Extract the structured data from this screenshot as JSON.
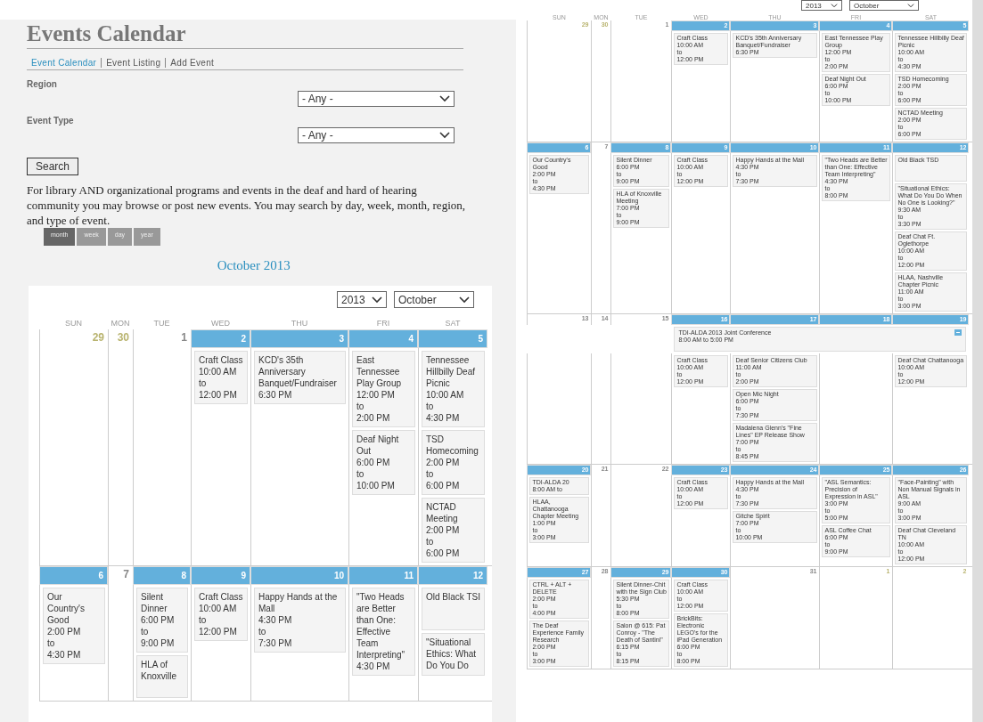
{
  "left": {
    "title": "Events Calendar",
    "nav": [
      {
        "label": "Event Calendar",
        "selected": true
      },
      {
        "label": "Event Listing",
        "selected": false
      },
      {
        "label": "Add Event",
        "selected": false
      }
    ],
    "filters": [
      {
        "label": "Region",
        "value": "- Any -"
      },
      {
        "label": "Event Type",
        "value": "- Any -"
      }
    ],
    "search_button": "Search",
    "description": "For library AND organizational programs and events in the deaf and hard of hearing community you may browse or post new events. You may search by day, week, month, region, and type of event.",
    "views": [
      {
        "label": "month",
        "selected": true
      },
      {
        "label": "week",
        "selected": false
      },
      {
        "label": "day",
        "selected": false
      },
      {
        "label": "year",
        "selected": false
      }
    ],
    "month_title": "October 2013",
    "year_select": "2013",
    "month_select": "October",
    "calendar": {
      "weekdays": [
        "SUN",
        "MON",
        "TUE",
        "WED",
        "THU",
        "FRI",
        "SAT"
      ],
      "weeks": [
        {
          "days": [
            {
              "day": "29",
              "other_month": true,
              "has_events": false
            },
            {
              "day": "30",
              "other_month": true,
              "has_events": false
            },
            {
              "day": "1",
              "other_month": false,
              "has_events": false
            },
            {
              "day": "2",
              "other_month": false,
              "has_events": true,
              "events": [
                {
                  "title": "Craft Class",
                  "lines": [
                    "10:00 AM",
                    "to",
                    "12:00 PM"
                  ]
                }
              ]
            },
            {
              "day": "3",
              "other_month": false,
              "has_events": true,
              "events": [
                {
                  "title": "KCD's 35th Anniversary Banquet/Fundraiser",
                  "lines": [
                    "6:30 PM"
                  ]
                }
              ]
            },
            {
              "day": "4",
              "other_month": false,
              "has_events": true,
              "events": [
                {
                  "title": "East Tennessee Play Group",
                  "lines": [
                    "12:00 PM",
                    "to",
                    "2:00 PM"
                  ]
                },
                {
                  "title": "Deaf Night Out",
                  "lines": [
                    "6:00 PM",
                    "to",
                    "10:00 PM"
                  ]
                }
              ]
            },
            {
              "day": "5",
              "other_month": false,
              "has_events": true,
              "events": [
                {
                  "title": "Tennessee Hillbilly Deaf Picnic",
                  "lines": [
                    "10:00 AM",
                    "to",
                    "4:30 PM"
                  ]
                },
                {
                  "title": "TSD Homecoming",
                  "lines": [
                    "2:00 PM",
                    "to",
                    "6:00 PM"
                  ]
                },
                {
                  "title": "NCTAD Meeting",
                  "lines": [
                    "2:00 PM",
                    "to",
                    "6:00 PM"
                  ]
                }
              ]
            }
          ]
        },
        {
          "days": [
            {
              "day": "6",
              "other_month": false,
              "has_events": true,
              "events": [
                {
                  "title": "Our Country's Good",
                  "lines": [
                    "2:00 PM",
                    "to",
                    "4:30 PM"
                  ]
                }
              ]
            },
            {
              "day": "7",
              "other_month": false,
              "has_events": false
            },
            {
              "day": "8",
              "other_month": false,
              "has_events": true,
              "events": [
                {
                  "title": "Silent Dinner",
                  "lines": [
                    "6:00 PM",
                    "to",
                    "9:00 PM"
                  ]
                },
                {
                  "title": "HLA of Knoxville"
                }
              ]
            },
            {
              "day": "9",
              "other_month": false,
              "has_events": true,
              "events": [
                {
                  "title": "Craft Class",
                  "lines": [
                    "10:00 AM",
                    "to",
                    "12:00 PM"
                  ]
                }
              ]
            },
            {
              "day": "10",
              "other_month": false,
              "has_events": true,
              "events": [
                {
                  "title": "Happy Hands at the Mall",
                  "lines": [
                    "4:30 PM",
                    "to",
                    "7:30 PM"
                  ]
                }
              ]
            },
            {
              "day": "11",
              "other_month": false,
              "has_events": true,
              "events": [
                {
                  "title": "\"Two Heads are Better than One: Effective Team Interpreting\"",
                  "lines": [
                    "4:30 PM"
                  ]
                }
              ]
            },
            {
              "day": "12",
              "other_month": false,
              "has_events": true,
              "events": [
                {
                  "title": "Old Black TSI"
                },
                {
                  "title": "\"Situational Ethics: What Do You Do"
                }
              ]
            }
          ]
        }
      ]
    }
  },
  "right": {
    "year_select": "2013",
    "month_select": "October",
    "calendar": {
      "weekdays": [
        "SUN",
        "MON",
        "TUE",
        "WED",
        "THU",
        "FRI",
        "SAT"
      ],
      "weeks": [
        {
          "days": [
            {
              "day": "29",
              "other_month": true,
              "has_events": false
            },
            {
              "day": "30",
              "other_month": true,
              "has_events": false
            },
            {
              "day": "1",
              "other_month": false,
              "has_events": false
            },
            {
              "day": "2",
              "other_month": false,
              "has_events": true,
              "events": [
                {
                  "title": "Craft Class",
                  "lines": [
                    "10:00 AM",
                    "to",
                    "12:00 PM"
                  ]
                }
              ]
            },
            {
              "day": "3",
              "other_month": false,
              "has_events": true,
              "events": [
                {
                  "title": "KCD's 35th Anniversary Banquet/Fundraiser",
                  "lines": [
                    "6:30 PM"
                  ]
                }
              ]
            },
            {
              "day": "4",
              "other_month": false,
              "has_events": true,
              "events": [
                {
                  "title": "East Tennessee Play Group",
                  "lines": [
                    "12:00 PM",
                    "to",
                    "2:00 PM"
                  ]
                },
                {
                  "title": "Deaf Night Out",
                  "lines": [
                    "6:00 PM",
                    "to",
                    "10:00 PM"
                  ]
                }
              ]
            },
            {
              "day": "5",
              "other_month": false,
              "has_events": true,
              "events": [
                {
                  "title": "Tennessee Hillbilly Deaf Picnic",
                  "lines": [
                    "10:00 AM",
                    "to",
                    "4:30 PM"
                  ]
                },
                {
                  "title": "TSD Homecoming",
                  "lines": [
                    "2:00 PM",
                    "to",
                    "6:00 PM"
                  ]
                },
                {
                  "title": "NCTAD Meeting",
                  "lines": [
                    "2:00 PM",
                    "to",
                    "6:00 PM"
                  ]
                }
              ]
            }
          ]
        },
        {
          "days": [
            {
              "day": "6",
              "other_month": false,
              "has_events": true,
              "events": [
                {
                  "title": "Our Country's Good",
                  "lines": [
                    "2:00 PM",
                    "to",
                    "4:30 PM"
                  ]
                }
              ]
            },
            {
              "day": "7",
              "other_month": false,
              "has_events": false
            },
            {
              "day": "8",
              "other_month": false,
              "has_events": true,
              "events": [
                {
                  "title": "Silent Dinner",
                  "lines": [
                    "6:00 PM",
                    "to",
                    "9:00 PM"
                  ]
                },
                {
                  "title": "HLA of Knoxville Meeting",
                  "lines": [
                    "7:00 PM",
                    "to",
                    "9:00 PM"
                  ]
                }
              ]
            },
            {
              "day": "9",
              "other_month": false,
              "has_events": true,
              "events": [
                {
                  "title": "Craft Class",
                  "lines": [
                    "10:00 AM",
                    "to",
                    "12:00 PM"
                  ]
                }
              ]
            },
            {
              "day": "10",
              "other_month": false,
              "has_events": true,
              "events": [
                {
                  "title": "Happy Hands at the Mall",
                  "lines": [
                    "4:30 PM",
                    "to",
                    "7:30 PM"
                  ]
                }
              ]
            },
            {
              "day": "11",
              "other_month": false,
              "has_events": true,
              "events": [
                {
                  "title": "\"Two Heads are Better than One: Effective Team Interpreting\"",
                  "lines": [
                    "4:30 PM",
                    "to",
                    "8:00 PM"
                  ]
                }
              ]
            },
            {
              "day": "12",
              "other_month": false,
              "has_events": true,
              "events": [
                {
                  "title": "Old Black TSD"
                },
                {
                  "title": "\"Situational Ethics: What Do You Do When No One is Looking?\"",
                  "lines": [
                    "9:30 AM",
                    "to",
                    "3:30 PM"
                  ]
                },
                {
                  "title": "Deaf Chat Ft. Oglethorpe",
                  "lines": [
                    "10:00 AM",
                    "to",
                    "12:00 PM"
                  ]
                },
                {
                  "title": "HLAA, Nashville Chapter Picnic",
                  "lines": [
                    "11:00 AM",
                    "to",
                    "3:00 PM"
                  ]
                }
              ]
            }
          ]
        },
        {
          "days": [
            {
              "day": "13",
              "other_month": false,
              "has_events": false
            },
            {
              "day": "14",
              "other_month": false,
              "has_events": false
            },
            {
              "day": "15",
              "other_month": false,
              "has_events": false
            },
            {
              "day": "16",
              "other_month": false,
              "has_events": true,
              "in_span": true,
              "span_event": {
                "title": "TDI-ALDA 2013 Joint Conference",
                "lines": [
                  "8:00 AM to 5:00 PM"
                ]
              },
              "events": [
                {
                  "title": "Craft Class",
                  "lines": [
                    "10:00 AM",
                    "to",
                    "12:00 PM"
                  ]
                }
              ]
            },
            {
              "day": "17",
              "other_month": false,
              "has_events": true,
              "in_span": true,
              "events": [
                {
                  "title": "Deaf Senior Citizens Club",
                  "lines": [
                    "11:00 AM",
                    "to",
                    "2:00 PM"
                  ]
                },
                {
                  "title": "Open Mic Night",
                  "lines": [
                    "6:00 PM",
                    "to",
                    "7:30 PM"
                  ]
                },
                {
                  "title": "Madalena Glenn's \"Fine Lines\" EP Release Show",
                  "lines": [
                    "7:00 PM",
                    "to",
                    "8:45 PM"
                  ]
                }
              ]
            },
            {
              "day": "18",
              "other_month": false,
              "has_events": true,
              "in_span": true
            },
            {
              "day": "19",
              "other_month": false,
              "has_events": true,
              "in_span": true,
              "events": [
                {
                  "title": "Deaf Chat Chattanooga",
                  "lines": [
                    "10:00 AM",
                    "to",
                    "12:00 PM"
                  ]
                }
              ]
            }
          ]
        },
        {
          "days": [
            {
              "day": "20",
              "other_month": false,
              "has_events": true,
              "events": [
                {
                  "title": "TDI-ALDA 20",
                  "lines": [
                    "8:00 AM to"
                  ]
                },
                {
                  "title": "HLAA, Chattanooga Chapter Meeting",
                  "lines": [
                    "1:00 PM",
                    "to",
                    "3:00 PM"
                  ]
                }
              ]
            },
            {
              "day": "21",
              "other_month": false,
              "has_events": false
            },
            {
              "day": "22",
              "other_month": false,
              "has_events": false
            },
            {
              "day": "23",
              "other_month": false,
              "has_events": true,
              "events": [
                {
                  "title": "Craft Class",
                  "lines": [
                    "10:00 AM",
                    "to",
                    "12:00 PM"
                  ]
                }
              ]
            },
            {
              "day": "24",
              "other_month": false,
              "has_events": true,
              "events": [
                {
                  "title": "Happy Hands at the Mall",
                  "lines": [
                    "4:30 PM",
                    "to",
                    "7:30 PM"
                  ]
                },
                {
                  "title": "Gitche Spirit",
                  "lines": [
                    "7:00 PM",
                    "to",
                    "10:00 PM"
                  ]
                }
              ]
            },
            {
              "day": "25",
              "other_month": false,
              "has_events": true,
              "events": [
                {
                  "title": "\"ASL Semantics: Precision of Expression in ASL\"",
                  "lines": [
                    "3:00 PM",
                    "to",
                    "5:00 PM"
                  ]
                },
                {
                  "title": "ASL Coffee Chat",
                  "lines": [
                    "6:00 PM",
                    "to",
                    "9:00 PM"
                  ]
                }
              ]
            },
            {
              "day": "26",
              "other_month": false,
              "has_events": true,
              "events": [
                {
                  "title": "\"Face-Painting\" with Non Manual Signals in ASL",
                  "lines": [
                    "9:00 AM",
                    "to",
                    "3:00 PM"
                  ]
                },
                {
                  "title": "Deaf Chat Cleveland TN",
                  "lines": [
                    "10:00 AM",
                    "to",
                    "12:00 PM"
                  ]
                }
              ]
            }
          ]
        },
        {
          "days": [
            {
              "day": "27",
              "other_month": false,
              "has_events": true,
              "events": [
                {
                  "title": "CTRL + ALT + DELETE",
                  "lines": [
                    "2:00 PM",
                    "to",
                    "4:00 PM"
                  ]
                },
                {
                  "title": "The Deaf Experience Family Research",
                  "lines": [
                    "2:00 PM",
                    "to",
                    "3:00 PM"
                  ]
                }
              ]
            },
            {
              "day": "28",
              "other_month": false,
              "has_events": false
            },
            {
              "day": "29",
              "other_month": false,
              "has_events": true,
              "events": [
                {
                  "title": "Silent Dinner-Chit with the Sign Club",
                  "lines": [
                    "5:30 PM",
                    "to",
                    "8:00 PM"
                  ]
                },
                {
                  "title": "Salon @ 615: Pat Conroy - \"The Death of Santini\"",
                  "lines": [
                    "6:15 PM",
                    "to",
                    "8:15 PM"
                  ]
                }
              ]
            },
            {
              "day": "30",
              "other_month": false,
              "has_events": true,
              "events": [
                {
                  "title": "Craft Class",
                  "lines": [
                    "10:00 AM",
                    "to",
                    "12:00 PM"
                  ]
                },
                {
                  "title": "BrickBits: Electronic LEGO's for the iPad Generation",
                  "lines": [
                    "6:00 PM",
                    "to",
                    "8:00 PM"
                  ]
                }
              ]
            },
            {
              "day": "31",
              "other_month": false,
              "has_events": false
            },
            {
              "day": "1",
              "other_month": true,
              "has_events": false
            },
            {
              "day": "2",
              "other_month": true,
              "has_events": false
            }
          ]
        }
      ]
    }
  }
}
